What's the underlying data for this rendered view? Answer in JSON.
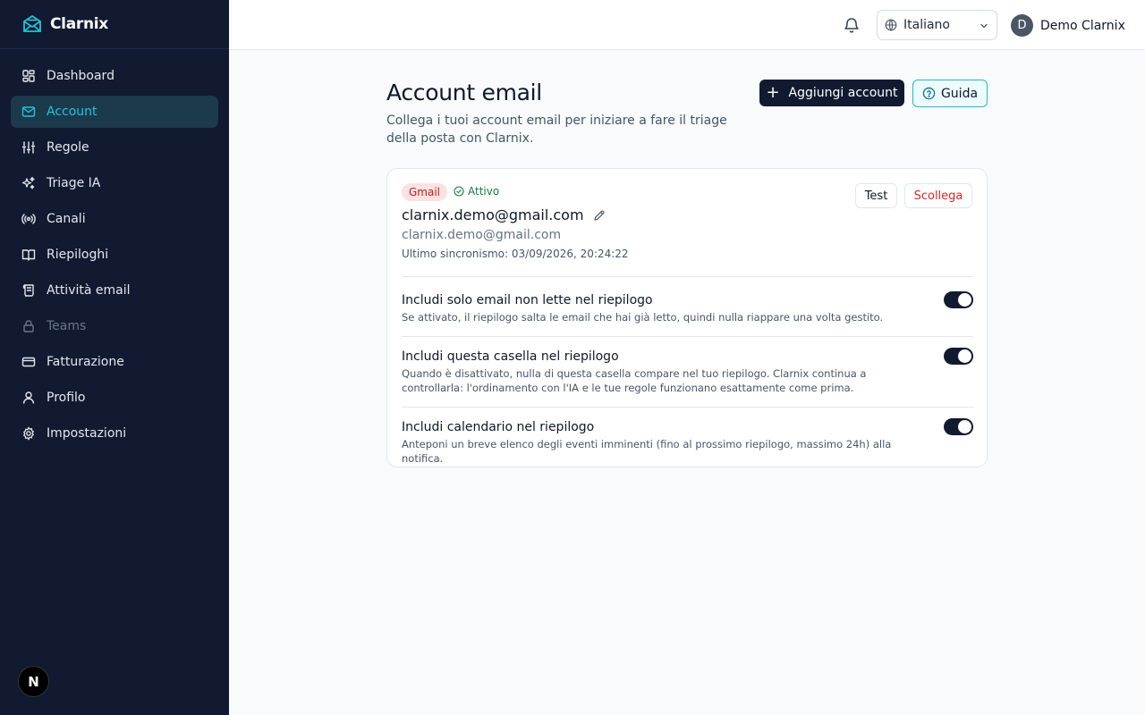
{
  "app": {
    "name": "Clarnix"
  },
  "sidebar": {
    "items": [
      {
        "label": "Dashboard",
        "icon": "dashboard-icon",
        "active": false,
        "disabled": false
      },
      {
        "label": "Account",
        "icon": "mail-icon",
        "active": true,
        "disabled": false
      },
      {
        "label": "Regole",
        "icon": "sliders-icon",
        "active": false,
        "disabled": false
      },
      {
        "label": "Triage IA",
        "icon": "sparkles-icon",
        "active": false,
        "disabled": false
      },
      {
        "label": "Canali",
        "icon": "broadcast-icon",
        "active": false,
        "disabled": false
      },
      {
        "label": "Riepiloghi",
        "icon": "book-icon",
        "active": false,
        "disabled": false
      },
      {
        "label": "Attività email",
        "icon": "scroll-icon",
        "active": false,
        "disabled": false
      },
      {
        "label": "Teams",
        "icon": "lock-icon",
        "active": false,
        "disabled": true
      },
      {
        "label": "Fatturazione",
        "icon": "credit-card-icon",
        "active": false,
        "disabled": false
      },
      {
        "label": "Profilo",
        "icon": "user-icon",
        "active": false,
        "disabled": false
      },
      {
        "label": "Impostazioni",
        "icon": "gear-icon",
        "active": false,
        "disabled": false
      }
    ],
    "badge": "N"
  },
  "header": {
    "language": "Italiano",
    "user": {
      "initial": "D",
      "name": "Demo Clarnix"
    }
  },
  "main": {
    "title": "Account email",
    "subtitle": "Collega i tuoi account email per iniziare a fare il triage della posta con Clarnix.",
    "add_button": "Aggiungi account",
    "guide_button": "Guida",
    "account": {
      "provider": "Gmail",
      "status": "Attivo",
      "email": "clarnix.demo@gmail.com",
      "address": "clarnix.demo@gmail.com",
      "last_sync": "Ultimo sincronismo: 03/09/2026, 20:24:22",
      "test_button": "Test",
      "disconnect_button": "Scollega",
      "options": [
        {
          "title": "Includi solo email non lette nel riepilogo",
          "description": "Se attivato, il riepilogo salta le email che hai già letto, quindi nulla riappare una volta gestito.",
          "enabled": true
        },
        {
          "title": "Includi questa casella nel riepilogo",
          "description": "Quando è disattivato, nulla di questa casella compare nel tuo riepilogo. Clarnix continua a controllarla: l'ordinamento con l'IA e le tue regole funzionano esattamente come prima.",
          "enabled": true
        },
        {
          "title": "Includi calendario nel riepilogo",
          "description": "Anteponi un breve elenco degli eventi imminenti (fino al prossimo riepilogo, massimo 24h) alla notifica.",
          "enabled": true
        }
      ]
    }
  },
  "colors": {
    "sidebar_bg": "#111a30",
    "accent": "#22c3d8",
    "danger": "#dc2626",
    "success": "#15803d"
  }
}
